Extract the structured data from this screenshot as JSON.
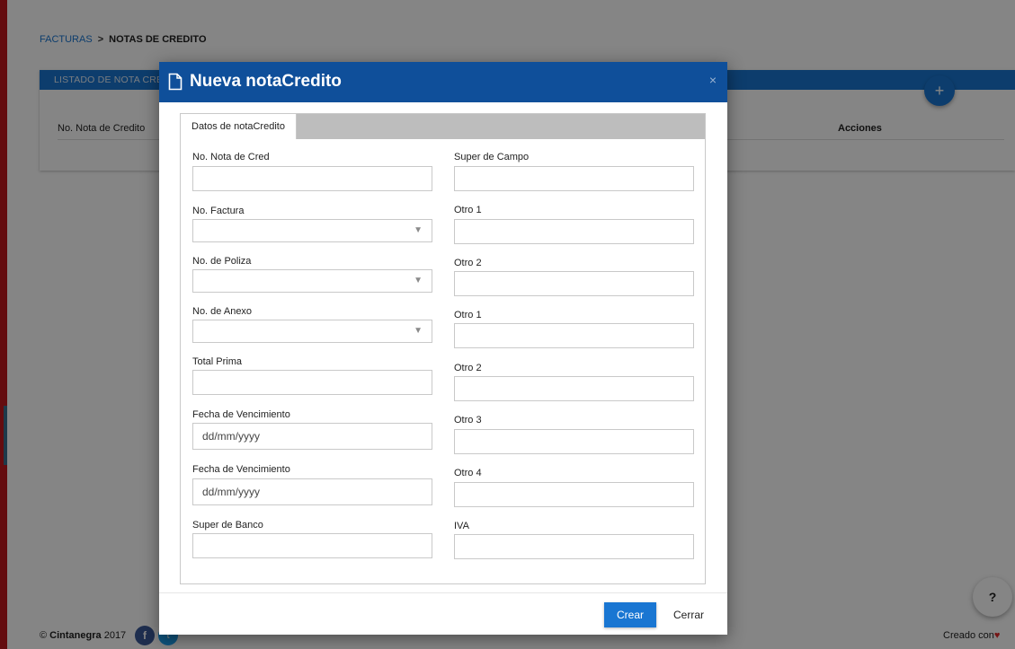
{
  "breadcrumb": {
    "parent": "FACTURAS",
    "separator": ">",
    "current": "NOTAS DE CREDITO"
  },
  "list": {
    "header": "LISTADO DE NOTA CREDITO",
    "add_label": "+",
    "columns": {
      "number": "No. Nota de Credito",
      "actions": "Acciones"
    }
  },
  "footer": {
    "brand": "Cintanegra",
    "year": "2017",
    "copyright": "©",
    "facebook": "f",
    "twitter": "t",
    "made_with": "Creado con",
    "heart": "♥"
  },
  "help_label": "?",
  "modal": {
    "title": "Nueva notaCredito",
    "close": "×",
    "tab": "Datos de notaCredito",
    "left_fields": [
      {
        "label": "No. Nota de Cred",
        "type": "text"
      },
      {
        "label": "No. Factura",
        "type": "select"
      },
      {
        "label": "No. de Poliza",
        "type": "select"
      },
      {
        "label": "No. de Anexo",
        "type": "select"
      },
      {
        "label": "Total Prima",
        "type": "text"
      },
      {
        "label": "Fecha de Vencimiento",
        "type": "date",
        "placeholder": "dd/mm/yyyy"
      },
      {
        "label": "Fecha de Vencimiento",
        "type": "date",
        "placeholder": "dd/mm/yyyy"
      },
      {
        "label": "Super de Banco",
        "type": "text"
      }
    ],
    "right_fields": [
      {
        "label": "Super de Campo"
      },
      {
        "label": "Otro 1"
      },
      {
        "label": "Otro 2"
      },
      {
        "label": "Otro 1"
      },
      {
        "label": "Otro 2"
      },
      {
        "label": "Otro 3"
      },
      {
        "label": "Otro 4"
      },
      {
        "label": "IVA"
      }
    ],
    "buttons": {
      "create": "Crear",
      "close": "Cerrar"
    }
  },
  "colors": {
    "accent": "#1976d2",
    "modal_header": "#0f4f9a",
    "sidebar": "#c0171d"
  }
}
